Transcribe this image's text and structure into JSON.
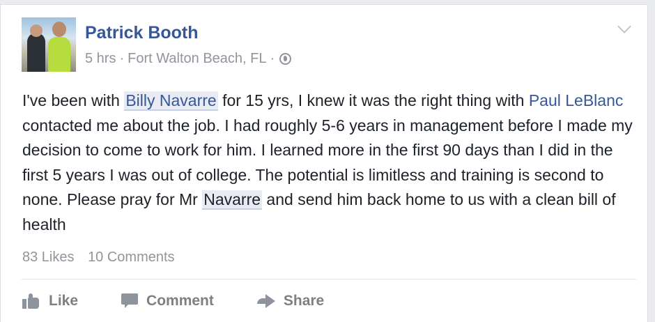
{
  "post": {
    "author": "Patrick Booth",
    "time": "5 hrs",
    "location": "Fort Walton Beach, FL",
    "sep1": "·",
    "sep2": "·",
    "text_parts": {
      "t1": "I've been with ",
      "mention1": "Billy Navarre",
      "t2": " for 15 yrs, I knew it was the right thing with ",
      "mention2": "Paul LeBlanc",
      "t3": " contacted me about the job. I had roughly 5-6 years in management before I made my decision to come to work for him. I learned more in the first 90 days than I did in the first 5 years I was out of college. The potential is limitless and training is second to none. Please pray for Mr ",
      "mention3": "Navarre",
      "t4": " and send him back home to us with a clean bill of health"
    },
    "likes": "83 Likes",
    "comments": "10 Comments"
  },
  "actions": {
    "like": "Like",
    "comment": "Comment",
    "share": "Share"
  },
  "icons": {
    "privacy": "globe-icon",
    "menu": "chevron-down-icon",
    "like": "thumbs-up-icon",
    "comment": "speech-bubble-icon",
    "share": "share-arrow-icon"
  },
  "colors": {
    "link": "#365899",
    "text": "#1d2129",
    "meta": "#90949c"
  }
}
